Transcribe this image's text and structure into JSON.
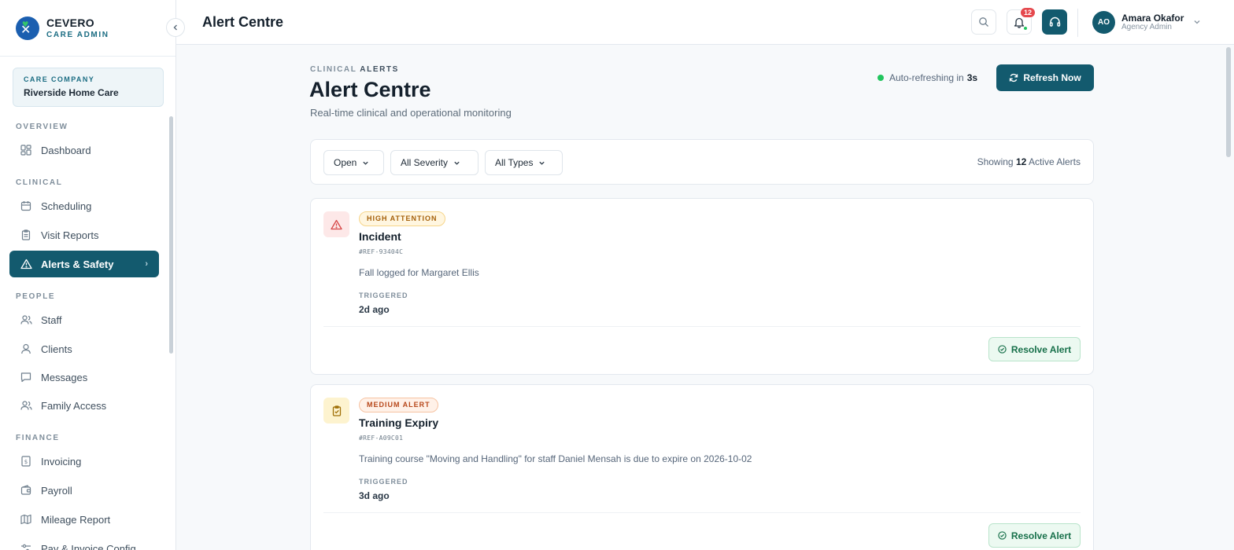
{
  "brand": {
    "name": "CEVERO",
    "sub": "CARE ADMIN"
  },
  "company": {
    "label": "CARE COMPANY",
    "name": "Riverside Home Care"
  },
  "nav": {
    "sections": [
      {
        "label": "OVERVIEW",
        "items": [
          {
            "label": "Dashboard",
            "icon": "dashboard-icon"
          }
        ]
      },
      {
        "label": "CLINICAL",
        "items": [
          {
            "label": "Scheduling",
            "icon": "calendar-icon"
          },
          {
            "label": "Visit Reports",
            "icon": "clipboard-icon"
          },
          {
            "label": "Alerts & Safety",
            "icon": "warning-icon",
            "active": true
          }
        ]
      },
      {
        "label": "PEOPLE",
        "items": [
          {
            "label": "Staff",
            "icon": "users-icon"
          },
          {
            "label": "Clients",
            "icon": "user-icon"
          },
          {
            "label": "Messages",
            "icon": "message-icon"
          },
          {
            "label": "Family Access",
            "icon": "family-icon"
          }
        ]
      },
      {
        "label": "FINANCE",
        "items": [
          {
            "label": "Invoicing",
            "icon": "invoice-icon"
          },
          {
            "label": "Payroll",
            "icon": "wallet-icon"
          },
          {
            "label": "Mileage Report",
            "icon": "map-icon"
          },
          {
            "label": "Pay & Invoice Config",
            "icon": "sliders-icon"
          }
        ]
      }
    ]
  },
  "topbar": {
    "title": "Alert Centre",
    "notification_count": "12",
    "user": {
      "initials": "AO",
      "name": "Amara Okafor",
      "role": "Agency Admin"
    }
  },
  "page": {
    "crumb_1": "CLINICAL",
    "crumb_2": "ALERTS",
    "title": "Alert Centre",
    "subtitle": "Real-time clinical and operational monitoring",
    "refresh_prefix": "Auto-refreshing in",
    "refresh_seconds": "3s",
    "refresh_button": "Refresh Now"
  },
  "filters": {
    "status": "Open",
    "severity": "All Severity",
    "type": "All Types",
    "showing_prefix": "Showing",
    "showing_count": "12",
    "showing_suffix": "Active Alerts"
  },
  "alerts": [
    {
      "severity": "HIGH ATTENTION",
      "title": "Incident",
      "ref": "#REF-93404C",
      "description": "Fall logged for Margaret Ellis",
      "triggered_label": "TRIGGERED",
      "triggered": "2d ago",
      "action": "Resolve Alert",
      "colors": {
        "icon_bg": "#fde8e8",
        "icon": "#d64545",
        "badge_bg": "#fff6e0",
        "badge_border": "#f6d58a",
        "badge_text": "#a5600a"
      }
    },
    {
      "severity": "MEDIUM ALERT",
      "title": "Training Expiry",
      "ref": "#REF-A09C01",
      "description": "Training course \"Moving and Handling\" for staff Daniel Mensah is due to expire on 2026-10-02",
      "triggered_label": "TRIGGERED",
      "triggered": "3d ago",
      "action": "Resolve Alert",
      "colors": {
        "icon_bg": "#fdf3cf",
        "icon": "#a07008",
        "badge_bg": "#fff1e8",
        "badge_border": "#f6c3a2",
        "badge_text": "#b7471a"
      }
    }
  ],
  "colors": {
    "primary": "#135a6e",
    "success": "#22c55e",
    "danger": "#e5484d"
  }
}
